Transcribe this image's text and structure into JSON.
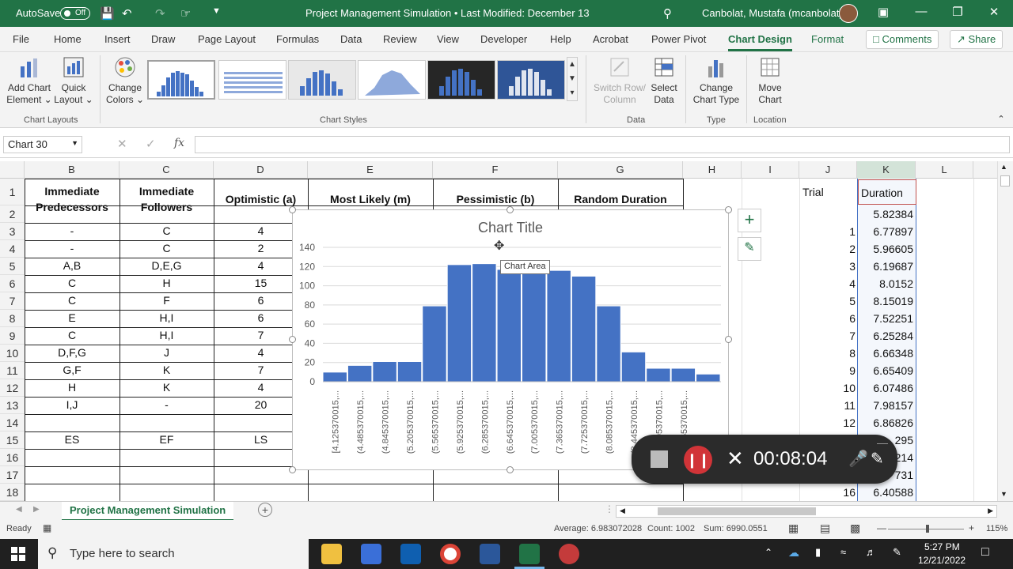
{
  "titlebar": {
    "autosave_label": "AutoSave",
    "autosave_state": "Off",
    "doc_title": "Project Management Simulation • Last Modified: December 13",
    "user_name": "Canbolat, Mustafa (mcanbolat)"
  },
  "menu": {
    "items": [
      "File",
      "Home",
      "Insert",
      "Draw",
      "Page Layout",
      "Formulas",
      "Data",
      "Review",
      "View",
      "Developer",
      "Help",
      "Acrobat",
      "Power Pivot",
      "Chart Design",
      "Format"
    ],
    "active": "Chart Design",
    "comments_label": "Comments",
    "share_label": "Share"
  },
  "ribbon": {
    "add_chart_element": [
      "Add Chart",
      "Element ⌄"
    ],
    "quick_layout": [
      "Quick",
      "Layout ⌄"
    ],
    "change_colors": [
      "Change",
      "Colors ⌄"
    ],
    "group_chart_layouts": "Chart Layouts",
    "group_chart_styles": "Chart Styles",
    "switch_row_column": [
      "Switch Row/",
      "Column"
    ],
    "select_data": [
      "Select",
      "Data"
    ],
    "group_data": "Data",
    "change_chart_type": [
      "Change",
      "Chart Type"
    ],
    "group_type": "Type",
    "move_chart": [
      "Move",
      "Chart"
    ],
    "group_location": "Location"
  },
  "formula_bar": {
    "name_box": "Chart 30",
    "fx_label": "fx",
    "content": ""
  },
  "columns": [
    "B",
    "C",
    "D",
    "E",
    "F",
    "G",
    "H",
    "I",
    "J",
    "K",
    "L"
  ],
  "rows": [
    "1",
    "2",
    "3",
    "4",
    "5",
    "6",
    "7",
    "8",
    "9",
    "10",
    "11",
    "12",
    "13",
    "14",
    "15",
    "16",
    "17",
    "18"
  ],
  "table": {
    "headers": [
      "Immediate Predecessors",
      "Immediate Followers",
      "Optimistic (a)",
      "Most Likely (m)",
      "Pessimistic (b)",
      "Random Duration"
    ],
    "predecessors": [
      "-",
      "-",
      "A,B",
      "C",
      "C",
      "E",
      "C",
      "D,F,G",
      "G,F",
      "H",
      "I,J"
    ],
    "followers": [
      "C",
      "C",
      "D,E,G",
      "H",
      "F",
      "H,I",
      "H,I",
      "J",
      "K",
      "K",
      "-"
    ],
    "optimistic": [
      "4",
      "2",
      "4",
      "15",
      "6",
      "6",
      "7",
      "4",
      "7",
      "4",
      "20"
    ],
    "row15": [
      "ES",
      "EF",
      "LS"
    ]
  },
  "trial_table": {
    "trial_header": "Trial",
    "duration_header": "Duration",
    "first_duration": "5.82384",
    "trials": [
      "1",
      "2",
      "3",
      "4",
      "5",
      "6",
      "7",
      "8",
      "9",
      "10",
      "11",
      "12",
      "",
      "",
      "",
      "16"
    ],
    "durations": [
      "6.77897",
      "5.96605",
      "6.19687",
      "8.0152",
      "8.15019",
      "7.52251",
      "6.25284",
      "6.66348",
      "6.65409",
      "6.07486",
      "7.98157",
      "6.86826",
      "295",
      "214",
      "731",
      "6.40588"
    ]
  },
  "chart_data": {
    "type": "bar",
    "title": "Chart Title",
    "categories": [
      "[4.125370015,",
      "(4.485370015,",
      "(4.845370015,",
      "(5.205370015,",
      "(5.565370015,",
      "(5.925370015,",
      "(6.285370015,",
      "(6.645370015,",
      "(7.005370015,",
      "(7.365370015,",
      "(7.725370015,",
      "(8.085370015,",
      "(8.445370015,",
      "(8.805370015,",
      "(9.165370015,"
    ],
    "tick_labels": [
      "[4.125370015,...",
      "(4.485370015,...",
      "(4.845370015,...",
      "(5.205370015,...",
      "(5.565370015,...",
      "(5.925370015,...",
      "(6.285370015,...",
      "(6.645370015,...",
      "(7.005370015,...",
      "(7.365370015,...",
      "(7.725370015,...",
      "(8.085370015,...",
      "(8.445370015,...",
      "(8.805370015,...",
      "(9.165370015,..."
    ],
    "values": [
      10,
      17,
      21,
      21,
      79,
      122,
      123,
      117,
      117,
      116,
      110,
      79,
      31,
      14,
      14,
      8
    ],
    "ylim": [
      0,
      140
    ],
    "yticks": [
      "0",
      "20",
      "40",
      "60",
      "80",
      "100",
      "120",
      "140"
    ],
    "color": "#4472c4",
    "grid": true,
    "xlabel": "",
    "ylabel": ""
  },
  "tooltip": "Chart Area",
  "sheet_tab": "Project Management Simulation",
  "status": {
    "ready": "Ready",
    "average": "Average: 6.983072028",
    "count": "Count: 1002",
    "sum": "Sum: 6990.0551",
    "zoom": "115%"
  },
  "recorder": {
    "time": "00:08:04"
  },
  "taskbar": {
    "search_placeholder": "Type here to search",
    "time": "5:27 PM",
    "date": "12/21/2022"
  }
}
